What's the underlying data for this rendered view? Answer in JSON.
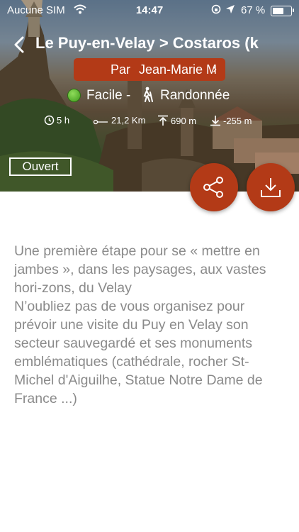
{
  "status_bar": {
    "carrier": "Aucune SIM",
    "time": "14:47",
    "battery_text": "67 %",
    "battery_level": 0.67
  },
  "header": {
    "title": "Le Puy-en-Velay > Costaros (k",
    "author_prefix": "Par",
    "author_name": "Jean-Marie M",
    "difficulty": "Facile -",
    "difficulty_color": "#3f9a1c",
    "activity": "Randonnée",
    "duration": "5 h",
    "distance": "21,2 Km",
    "ascent": "690 m",
    "descent": "-255 m",
    "state": "Ouvert"
  },
  "actions": {
    "share_icon": "share-icon",
    "download_icon": "download-icon"
  },
  "colors": {
    "accent": "#b33a17",
    "description_text": "#8a8a8a"
  },
  "description": [
    "Une première étape pour se « mettre en jambes », dans les paysages, aux vastes hori-zons, du Velay",
    "N’oubliez pas de vous organisez pour prévoir une visite du Puy en Velay son secteur sauvegardé et ses monuments emblématiques (cathédrale, rocher St-Michel d'Aiguilhe, Statue Notre Dame de France ...)"
  ]
}
